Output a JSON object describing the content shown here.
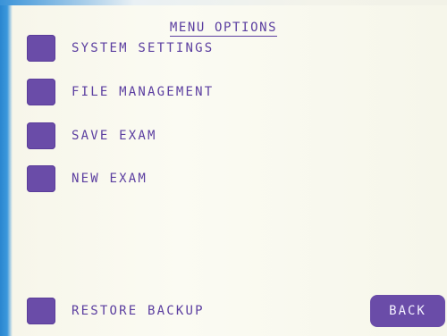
{
  "title": "MENU OPTIONS",
  "menu": {
    "items": [
      {
        "label": "SYSTEM SETTINGS"
      },
      {
        "label": "FILE MANAGEMENT"
      },
      {
        "label": "SAVE EXAM"
      },
      {
        "label": "NEW EXAM"
      },
      {
        "label": "RESTORE BACKUP"
      }
    ]
  },
  "back_label": "BACK",
  "colors": {
    "accent": "#6a4ca8",
    "text": "#5b3ea0",
    "background": "#fbfbf3",
    "frame": "#2f8fd6"
  }
}
